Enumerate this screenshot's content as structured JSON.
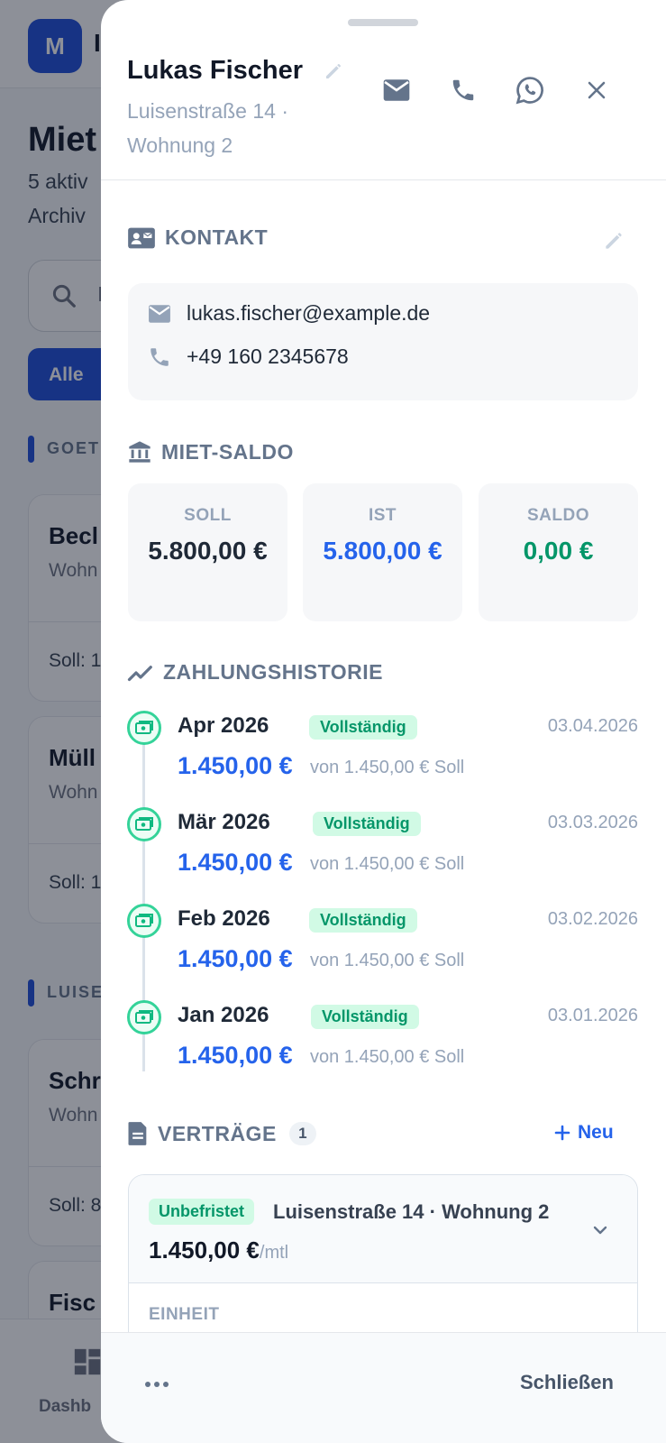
{
  "background": {
    "avatar_letter": "M",
    "app_initial": "I",
    "page_title": "Miet",
    "subtitle_1": "5 aktiv",
    "subtitle_2": "Archiv",
    "search_partial": "I",
    "filter_chip": "Alle",
    "group_1": "GOET",
    "group_2": "LUISE",
    "cards": [
      {
        "name": "Becl",
        "unit": "Wohn",
        "soll": "Soll: 1"
      },
      {
        "name": "Müll",
        "unit": "Wohn",
        "soll": "Soll: 1"
      },
      {
        "name": "Schr",
        "unit": "Wohn",
        "soll": "Soll: 8"
      },
      {
        "name": "Fisc"
      }
    ],
    "nav_label": "Dashb"
  },
  "sheet": {
    "tenant_name": "Lukas Fischer",
    "address_line_1": "Luisenstraße 14 ·",
    "address_line_2": "Wohnung 2",
    "contact": {
      "title": "KONTAKT",
      "email": "lukas.fischer@example.de",
      "phone": "+49 160 2345678"
    },
    "saldo": {
      "title": "MIET-SALDO",
      "soll_label": "SOLL",
      "soll_value": "5.800,00 €",
      "ist_label": "IST",
      "ist_value": "5.800,00 €",
      "saldo_label": "SALDO",
      "saldo_value": "0,00 €"
    },
    "history": {
      "title": "ZAHLUNGSHISTORIE",
      "payments": [
        {
          "month": "Apr 2026",
          "status": "Vollständig",
          "date": "03.04.2026",
          "amount": "1.450,00 €",
          "of": "von 1.450,00 € Soll"
        },
        {
          "month": "Mär 2026",
          "status": "Vollständig",
          "date": "03.03.2026",
          "amount": "1.450,00 €",
          "of": "von 1.450,00 € Soll"
        },
        {
          "month": "Feb 2026",
          "status": "Vollständig",
          "date": "03.02.2026",
          "amount": "1.450,00 €",
          "of": "von 1.450,00 € Soll"
        },
        {
          "month": "Jan 2026",
          "status": "Vollständig",
          "date": "03.01.2026",
          "amount": "1.450,00 €",
          "of": "von 1.450,00 € Soll"
        }
      ]
    },
    "contracts": {
      "title": "VERTRÄGE",
      "count": "1",
      "new_label": "Neu",
      "items": [
        {
          "status": "Unbefristet",
          "address": "Luisenstraße 14 · Wohnung 2",
          "rent": "1.450,00 €",
          "rent_unit": "/mtl",
          "section_label": "EINHEIT"
        }
      ]
    },
    "footer": {
      "close_label": "Schließen"
    }
  },
  "colors": {
    "accent": "#2563eb",
    "success": "#059669",
    "muted": "#94a3b8"
  }
}
